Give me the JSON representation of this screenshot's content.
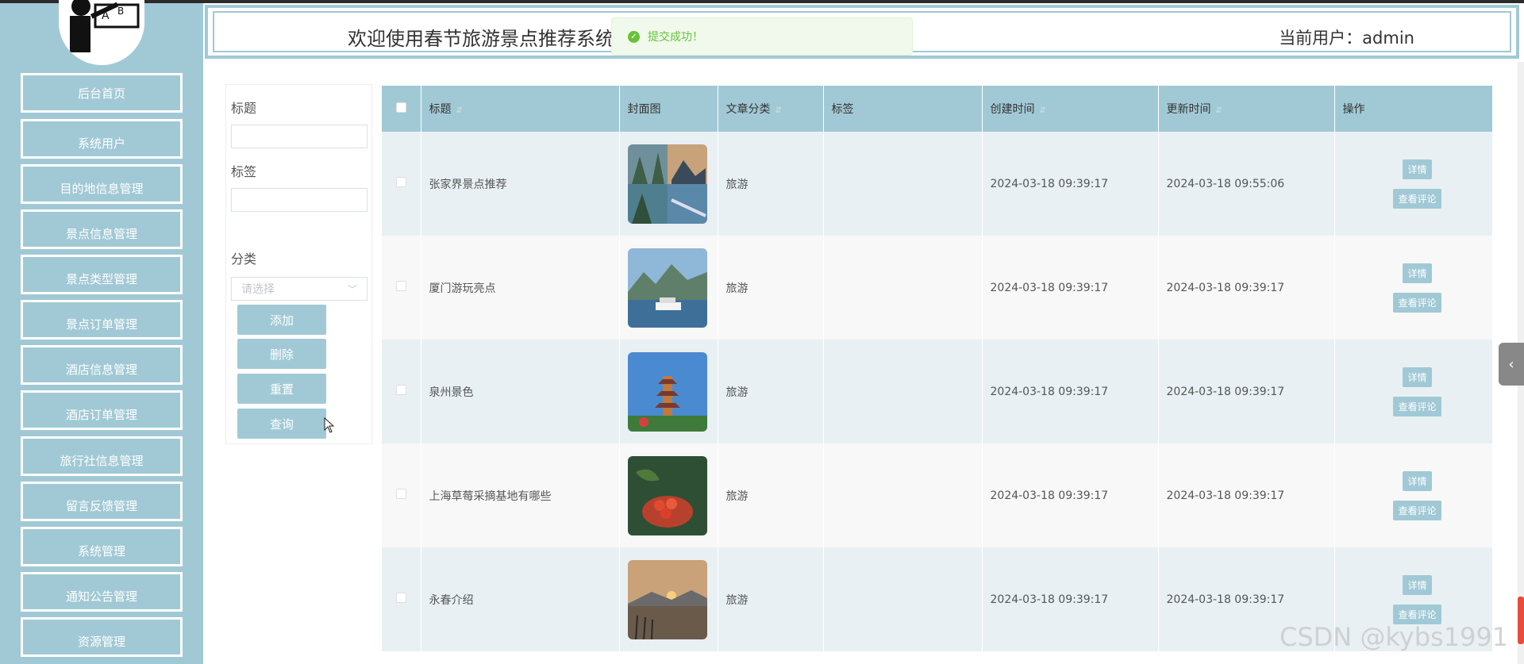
{
  "sidebar": {
    "items": [
      {
        "label": "后台首页"
      },
      {
        "label": "系统用户"
      },
      {
        "label": "目的地信息管理"
      },
      {
        "label": "景点信息管理"
      },
      {
        "label": "景点类型管理"
      },
      {
        "label": "景点订单管理"
      },
      {
        "label": "酒店信息管理"
      },
      {
        "label": "酒店订单管理"
      },
      {
        "label": "旅行社信息管理"
      },
      {
        "label": "留言反馈管理"
      },
      {
        "label": "系统管理"
      },
      {
        "label": "通知公告管理"
      },
      {
        "label": "资源管理"
      }
    ]
  },
  "header": {
    "title": "欢迎使用春节旅游景点推荐系统",
    "user_label": "当前用户：admin"
  },
  "toast": {
    "message": "提交成功！"
  },
  "filters": {
    "title_label": "标题",
    "tag_label": "标签",
    "category_label": "分类",
    "category_placeholder": "请选择",
    "buttons": {
      "add": "添加",
      "delete": "删除",
      "reset": "重置",
      "query": "查询"
    }
  },
  "table": {
    "columns": {
      "title": "标题",
      "cover": "封面图",
      "category": "文章分类",
      "tags": "标签",
      "created": "创建时间",
      "updated": "更新时间",
      "actions": "操作"
    },
    "rows": [
      {
        "title": "张家界景点推荐",
        "category": "旅游",
        "tags": "",
        "created": "2024-03-18 09:39:17",
        "updated": "2024-03-18 09:55:06"
      },
      {
        "title": "厦门游玩亮点",
        "category": "旅游",
        "tags": "",
        "created": "2024-03-18 09:39:17",
        "updated": "2024-03-18 09:39:17"
      },
      {
        "title": "泉州景色",
        "category": "旅游",
        "tags": "",
        "created": "2024-03-18 09:39:17",
        "updated": "2024-03-18 09:39:17"
      },
      {
        "title": "上海草莓采摘基地有哪些",
        "category": "旅游",
        "tags": "",
        "created": "2024-03-18 09:39:17",
        "updated": "2024-03-18 09:39:17"
      },
      {
        "title": "永春介绍",
        "category": "旅游",
        "tags": "",
        "created": "2024-03-18 09:39:17",
        "updated": "2024-03-18 09:39:17"
      }
    ],
    "detail_label": "详情",
    "comments_label": "查看评论"
  },
  "watermark": "CSDN @kybs1991",
  "colors": {
    "accent": "#a1c9d5",
    "success": "#67c23a"
  }
}
